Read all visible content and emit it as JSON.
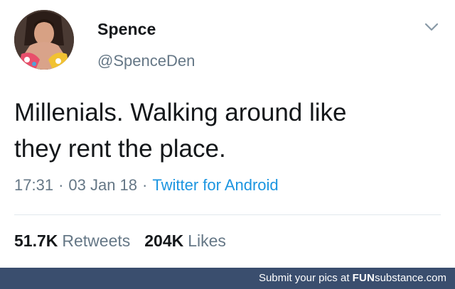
{
  "tweet": {
    "display_name": "Spence",
    "handle": "@SpenceDen",
    "text": "Millenials. Walking around like\nthey rent the place.",
    "time": "17:31",
    "date": "03 Jan 18",
    "source": "Twitter for Android",
    "retweets_count": "51.7K",
    "retweets_label": "Retweets",
    "likes_count": "204K",
    "likes_label": "Likes",
    "separator": "·"
  },
  "footer": {
    "prefix": "Submit your pics at ",
    "brand_a": "FUN",
    "brand_b": "substance",
    "brand_c": ".com"
  },
  "icons": {
    "avatar": "avatar",
    "menu": "chevron-down-icon"
  },
  "colors": {
    "link": "#1b95e0",
    "muted": "#657786",
    "footer_bg": "#3a4e6e"
  }
}
